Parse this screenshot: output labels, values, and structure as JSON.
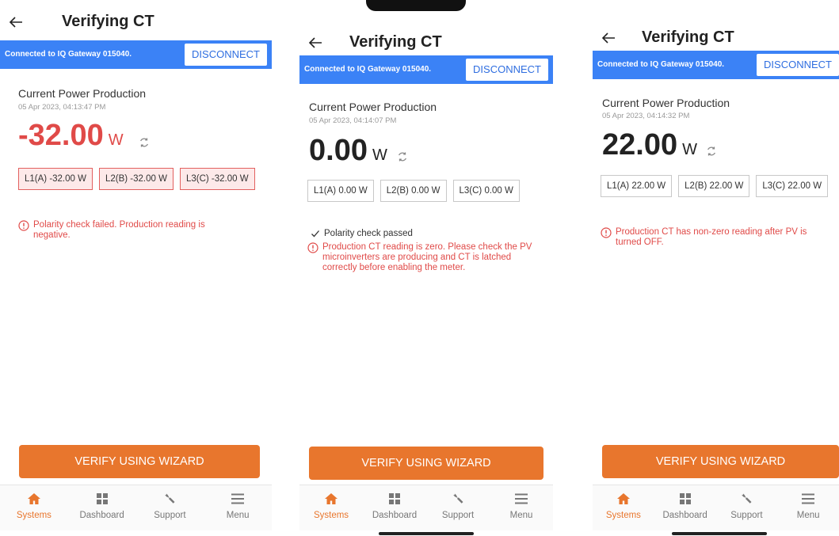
{
  "colors": {
    "accent": "#e8762d",
    "blue": "#3b82f6",
    "error": "#e04a48",
    "tab_inactive": "#777777"
  },
  "screens": [
    {
      "title": "Verifying CT",
      "connection_text": "Connected to IQ Gateway 015040.",
      "disconnect_label": "DISCONNECT",
      "production_label": "Current Power Production",
      "timestamp": "05 Apr 2023, 04:13:47 PM",
      "power_value": "-32.00",
      "power_unit": "W",
      "power_color": "#e04a48",
      "phases": [
        "L1(A) -32.00 W",
        "L2(B) -32.00 W",
        "L3(C) -32.00 W"
      ],
      "phase_error": true,
      "pass_text": "",
      "messages": [
        "Polarity check failed. Production reading is negative."
      ],
      "verify_label": "VERIFY USING WIZARD",
      "tabs": [
        "Systems",
        "Dashboard",
        "Support",
        "Menu"
      ],
      "icons": [
        "back-arrow-icon",
        "refresh-icon",
        "warning-icon",
        "home-icon",
        "dashboard-icon",
        "wrench-icon",
        "menu-icon"
      ]
    },
    {
      "title": "Verifying CT",
      "connection_text": "Connected to IQ Gateway 015040.",
      "disconnect_label": "DISCONNECT",
      "production_label": "Current Power Production",
      "timestamp": "05 Apr 2023, 04:14:07 PM",
      "power_value": "0.00",
      "power_unit": "W",
      "power_color": "#222222",
      "phases": [
        "L1(A) 0.00 W",
        "L2(B) 0.00 W",
        "L3(C) 0.00 W"
      ],
      "phase_error": false,
      "pass_text": "Polarity check passed",
      "messages": [
        "Production CT reading is zero. Please check the PV microinverters are producing and CT is latched correctly before enabling the meter."
      ],
      "verify_label": "VERIFY USING WIZARD",
      "tabs": [
        "Systems",
        "Dashboard",
        "Support",
        "Menu"
      ],
      "icons": [
        "back-arrow-icon",
        "refresh-icon",
        "checkmark-icon",
        "warning-icon",
        "home-icon",
        "dashboard-icon",
        "wrench-icon",
        "menu-icon"
      ]
    },
    {
      "title": "Verifying CT",
      "connection_text": "Connected to IQ Gateway 015040.",
      "disconnect_label": "DISCONNECT",
      "production_label": "Current Power Production",
      "timestamp": "05 Apr 2023, 04:14:32 PM",
      "power_value": "22.00",
      "power_unit": "W",
      "power_color": "#222222",
      "phases": [
        "L1(A) 22.00 W",
        "L2(B) 22.00 W",
        "L3(C) 22.00 W"
      ],
      "phase_error": false,
      "pass_text": "",
      "messages": [
        "Production CT has non-zero reading after PV is turned OFF."
      ],
      "verify_label": "VERIFY USING WIZARD",
      "tabs": [
        "Systems",
        "Dashboard",
        "Support",
        "Menu"
      ],
      "icons": [
        "back-arrow-icon",
        "refresh-icon",
        "warning-icon",
        "home-icon",
        "dashboard-icon",
        "wrench-icon",
        "menu-icon"
      ]
    }
  ]
}
